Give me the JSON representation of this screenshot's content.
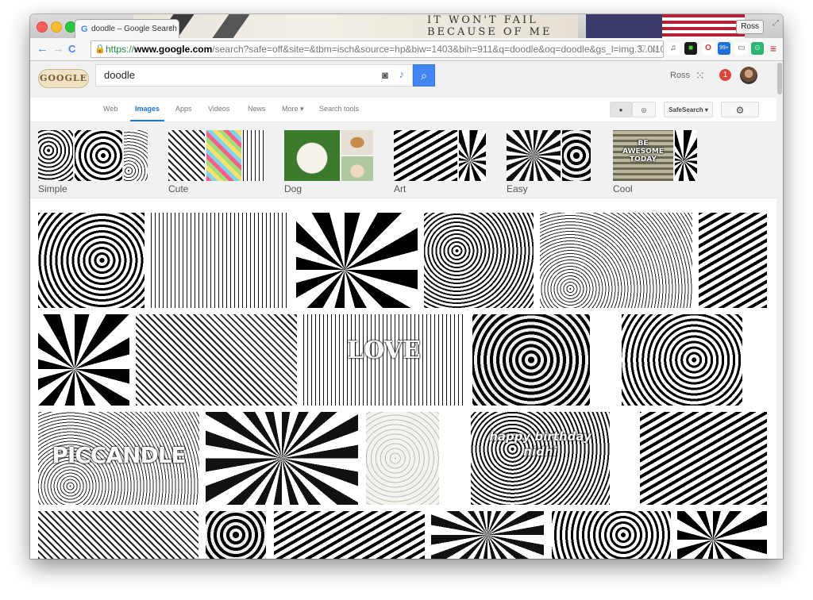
{
  "browser": {
    "tab_title": "doodle – Google Search",
    "tab_favicon": "G",
    "tab_close": "×",
    "profile": "Ross",
    "background_text": "IT WON'T FAIL BECAUSE OF ME",
    "url_scheme": "https://",
    "url_host": "www.google.com",
    "url_rest": "/search?safe=off&site=&tbm=isch&source=hp&biw=1403&bih=911&q=doodle&oq=doodle&gs_l=img.3..0l10.841.1...",
    "back_icon": "←",
    "forward_icon": "→",
    "reload_icon": "C",
    "lock_icon": "🔒",
    "star_icon": "☆",
    "menu_icon": "≡",
    "ext_badge": "99+"
  },
  "google": {
    "logo": "GOOGLE",
    "query": "doodle",
    "camera_icon": "📷",
    "mic_icon": "🎤",
    "search_icon": "🔍",
    "user": "Ross",
    "apps_icon": "⁙",
    "notification_count": "1"
  },
  "nav": {
    "tabs": [
      "Web",
      "Images",
      "Apps",
      "Videos",
      "News",
      "More ▾",
      "Search tools"
    ],
    "active_tab": "Images",
    "person_icon": "👤",
    "globe_icon": "◎",
    "safesearch": "SafeSearch ▾",
    "settings_icon": "⚙"
  },
  "related": [
    {
      "label": "Simple"
    },
    {
      "label": "Cute"
    },
    {
      "label": "Dog"
    },
    {
      "label": "Art"
    },
    {
      "label": "Easy"
    },
    {
      "label": "Cool"
    }
  ],
  "cool_text": [
    "BE",
    "AWESOME",
    "TODAY"
  ],
  "image_captions": {
    "love": "LOVE",
    "candle": "PICCANDLE",
    "birthday": "happy birthday nidhi"
  }
}
